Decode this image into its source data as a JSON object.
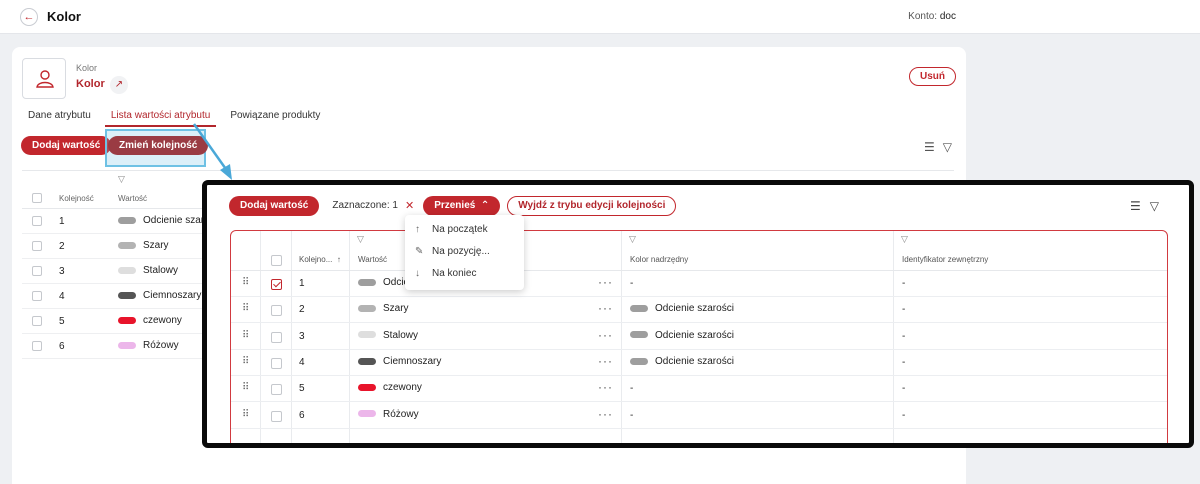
{
  "topbar": {
    "title": "Kolor",
    "account_label": "Konto:",
    "account_value": "doc"
  },
  "attribute": {
    "subtitle": "Kolor",
    "name": "Kolor",
    "delete_label": "Usuń"
  },
  "tabs": [
    {
      "label": "Dane atrybutu",
      "active": false
    },
    {
      "label": "Lista wartości atrybutu",
      "active": true
    },
    {
      "label": "Powiązane produkty",
      "active": false
    }
  ],
  "actions": {
    "add_value": "Dodaj wartość",
    "change_order": "Zmień kolejność"
  },
  "table": {
    "columns": {
      "order": "Kolejność",
      "order_short": "Kolejno...",
      "value": "Wartość",
      "parent_color": "Kolor nadrzędny",
      "external_id": "Identyfikator zewnętrzny"
    },
    "rows": [
      {
        "order": "1",
        "value": "Odcienie szarości",
        "value_bg": "Odcienie szaro",
        "value_zoom": "Odcie",
        "color": "#9e9e9e",
        "parent": "-",
        "parent_color": "",
        "external": "-",
        "checked": true
      },
      {
        "order": "2",
        "value": "Szary",
        "value_bg": "Szary",
        "value_zoom": "Szary",
        "color": "#b3b3b3",
        "parent": "Odcienie szarości",
        "parent_color": "#9e9e9e",
        "external": "-",
        "checked": false
      },
      {
        "order": "3",
        "value": "Stalowy",
        "value_bg": "Stalowy",
        "value_zoom": "Stalowy",
        "color": "#dedede",
        "parent": "Odcienie szarości",
        "parent_color": "#9e9e9e",
        "external": "-",
        "checked": false
      },
      {
        "order": "4",
        "value": "Ciemnoszary",
        "value_bg": "Ciemnoszary",
        "value_zoom": "Ciemnoszary",
        "color": "#555555",
        "parent": "Odcienie szarości",
        "parent_color": "#9e9e9e",
        "external": "-",
        "checked": false
      },
      {
        "order": "5",
        "value": "czewony",
        "value_bg": "czewony",
        "value_zoom": "czewony",
        "color": "#e8142b",
        "parent": "-",
        "parent_color": "",
        "external": "-",
        "checked": false
      },
      {
        "order": "6",
        "value": "Różowy",
        "value_bg": "Różowy",
        "value_zoom": "Różowy",
        "color": "#ecb6ea",
        "parent": "-",
        "parent_color": "",
        "external": "-",
        "checked": false
      }
    ]
  },
  "zoom": {
    "add_value": "Dodaj wartość",
    "selected_label": "Zaznaczone: 1",
    "move_label": "Przenieś",
    "exit_label": "Wyjdź z trybu edycji kolejności",
    "menu": [
      {
        "icon": "arrow-up-icon",
        "glyph": "↑",
        "label": "Na początek"
      },
      {
        "icon": "pencil-icon",
        "glyph": "✎",
        "label": "Na pozycję..."
      },
      {
        "icon": "arrow-down-icon",
        "glyph": "↓",
        "label": "Na koniec"
      }
    ]
  },
  "colors": {
    "accent": "#c2272d",
    "highlight": "#6ec1e4",
    "overlay_border": "#0a0a0a"
  }
}
